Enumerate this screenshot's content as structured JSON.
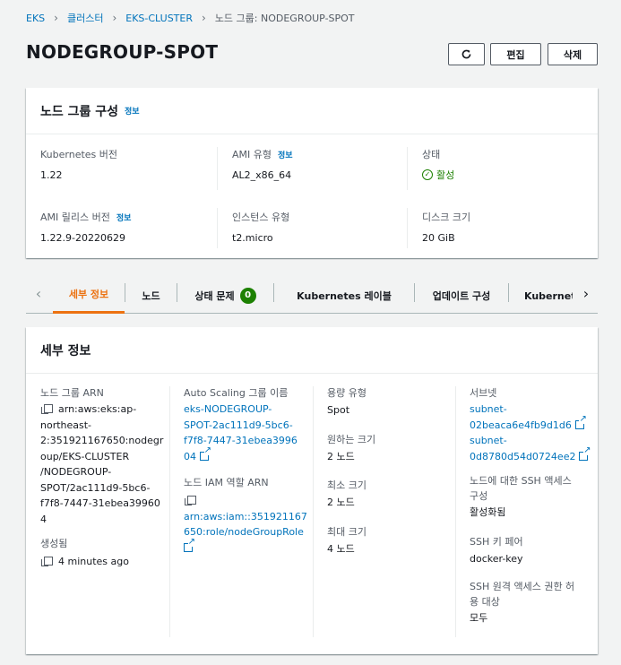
{
  "breadcrumb": {
    "items": [
      "EKS",
      "클러스터",
      "EKS-CLUSTER"
    ],
    "current": "노드 그룹: NODEGROUP-SPOT"
  },
  "page": {
    "title": "NODEGROUP-SPOT",
    "edit_label": "편집",
    "delete_label": "삭제",
    "refresh_icon": "refresh-icon"
  },
  "config": {
    "title": "노드 그룹 구성",
    "info": "정보",
    "kubernetes_version": {
      "label": "Kubernetes 버전",
      "value": "1.22"
    },
    "ami_type": {
      "label": "AMI 유형",
      "info": "정보",
      "value": "AL2_x86_64"
    },
    "status": {
      "label": "상태",
      "value": "활성"
    },
    "ami_release": {
      "label": "AMI 릴리스 버전",
      "info": "정보",
      "value": "1.22.9-20220629"
    },
    "instance_type": {
      "label": "인스턴스 유형",
      "value": "t2.micro"
    },
    "disk_size": {
      "label": "디스크 크기",
      "value": "20 GiB"
    }
  },
  "tabs": {
    "items": [
      "세부 정보",
      "노드",
      "상태 문제",
      "Kubernetes 레이블",
      "업데이트 구성",
      "Kubernetes 테인"
    ],
    "issues_count": "0",
    "active_color": "#ec7211"
  },
  "details": {
    "title": "세부 정보",
    "arn_label": "노드 그룹 ARN",
    "arn_lines": [
      "arn:aws:eks:ap-",
      "northeast-",
      "2:351921167650:nodegr",
      "oup/EKS-CLUSTER",
      "/NODEGROUP-",
      "SPOT/2ac111d9-5bc6-",
      "f7f8-7447-31ebea39960",
      "4"
    ],
    "created_label": "생성됨",
    "created_value": "4 minutes ago",
    "asg_label": "Auto Scaling 그룹 이름",
    "asg_lines": [
      "eks-NODEGROUP-",
      "SPOT-2ac111d9-5bc6-",
      "f7f8-7447-31ebea3996",
      "04"
    ],
    "iam_label": "노드 IAM 역할 ARN",
    "iam_lines": [
      "arn:aws:iam::351921167",
      "650:role/nodeGroupRole"
    ],
    "capacity_label": "용량 유형",
    "capacity_value": "Spot",
    "desired_label": "원하는 크기",
    "desired_value": "2 노드",
    "min_label": "최소 크기",
    "min_value": "2 노드",
    "max_label": "최대 크기",
    "max_value": "4 노드",
    "subnets_label": "서브넷",
    "subnets": [
      [
        "subnet-",
        "02beaca6e4fb9d1d6"
      ],
      [
        "subnet-",
        "0d8780d54d0724ee2"
      ]
    ],
    "ssh_label_lines": [
      "노드에 대한 SSH 액세스",
      "구성"
    ],
    "ssh_value": "활성화됨",
    "keypair_label": "SSH 키 페어",
    "keypair_value": "docker-key",
    "remote_label_lines": [
      "SSH 원격 액세스 권한 허",
      "용 대상"
    ],
    "remote_value": "모두"
  }
}
